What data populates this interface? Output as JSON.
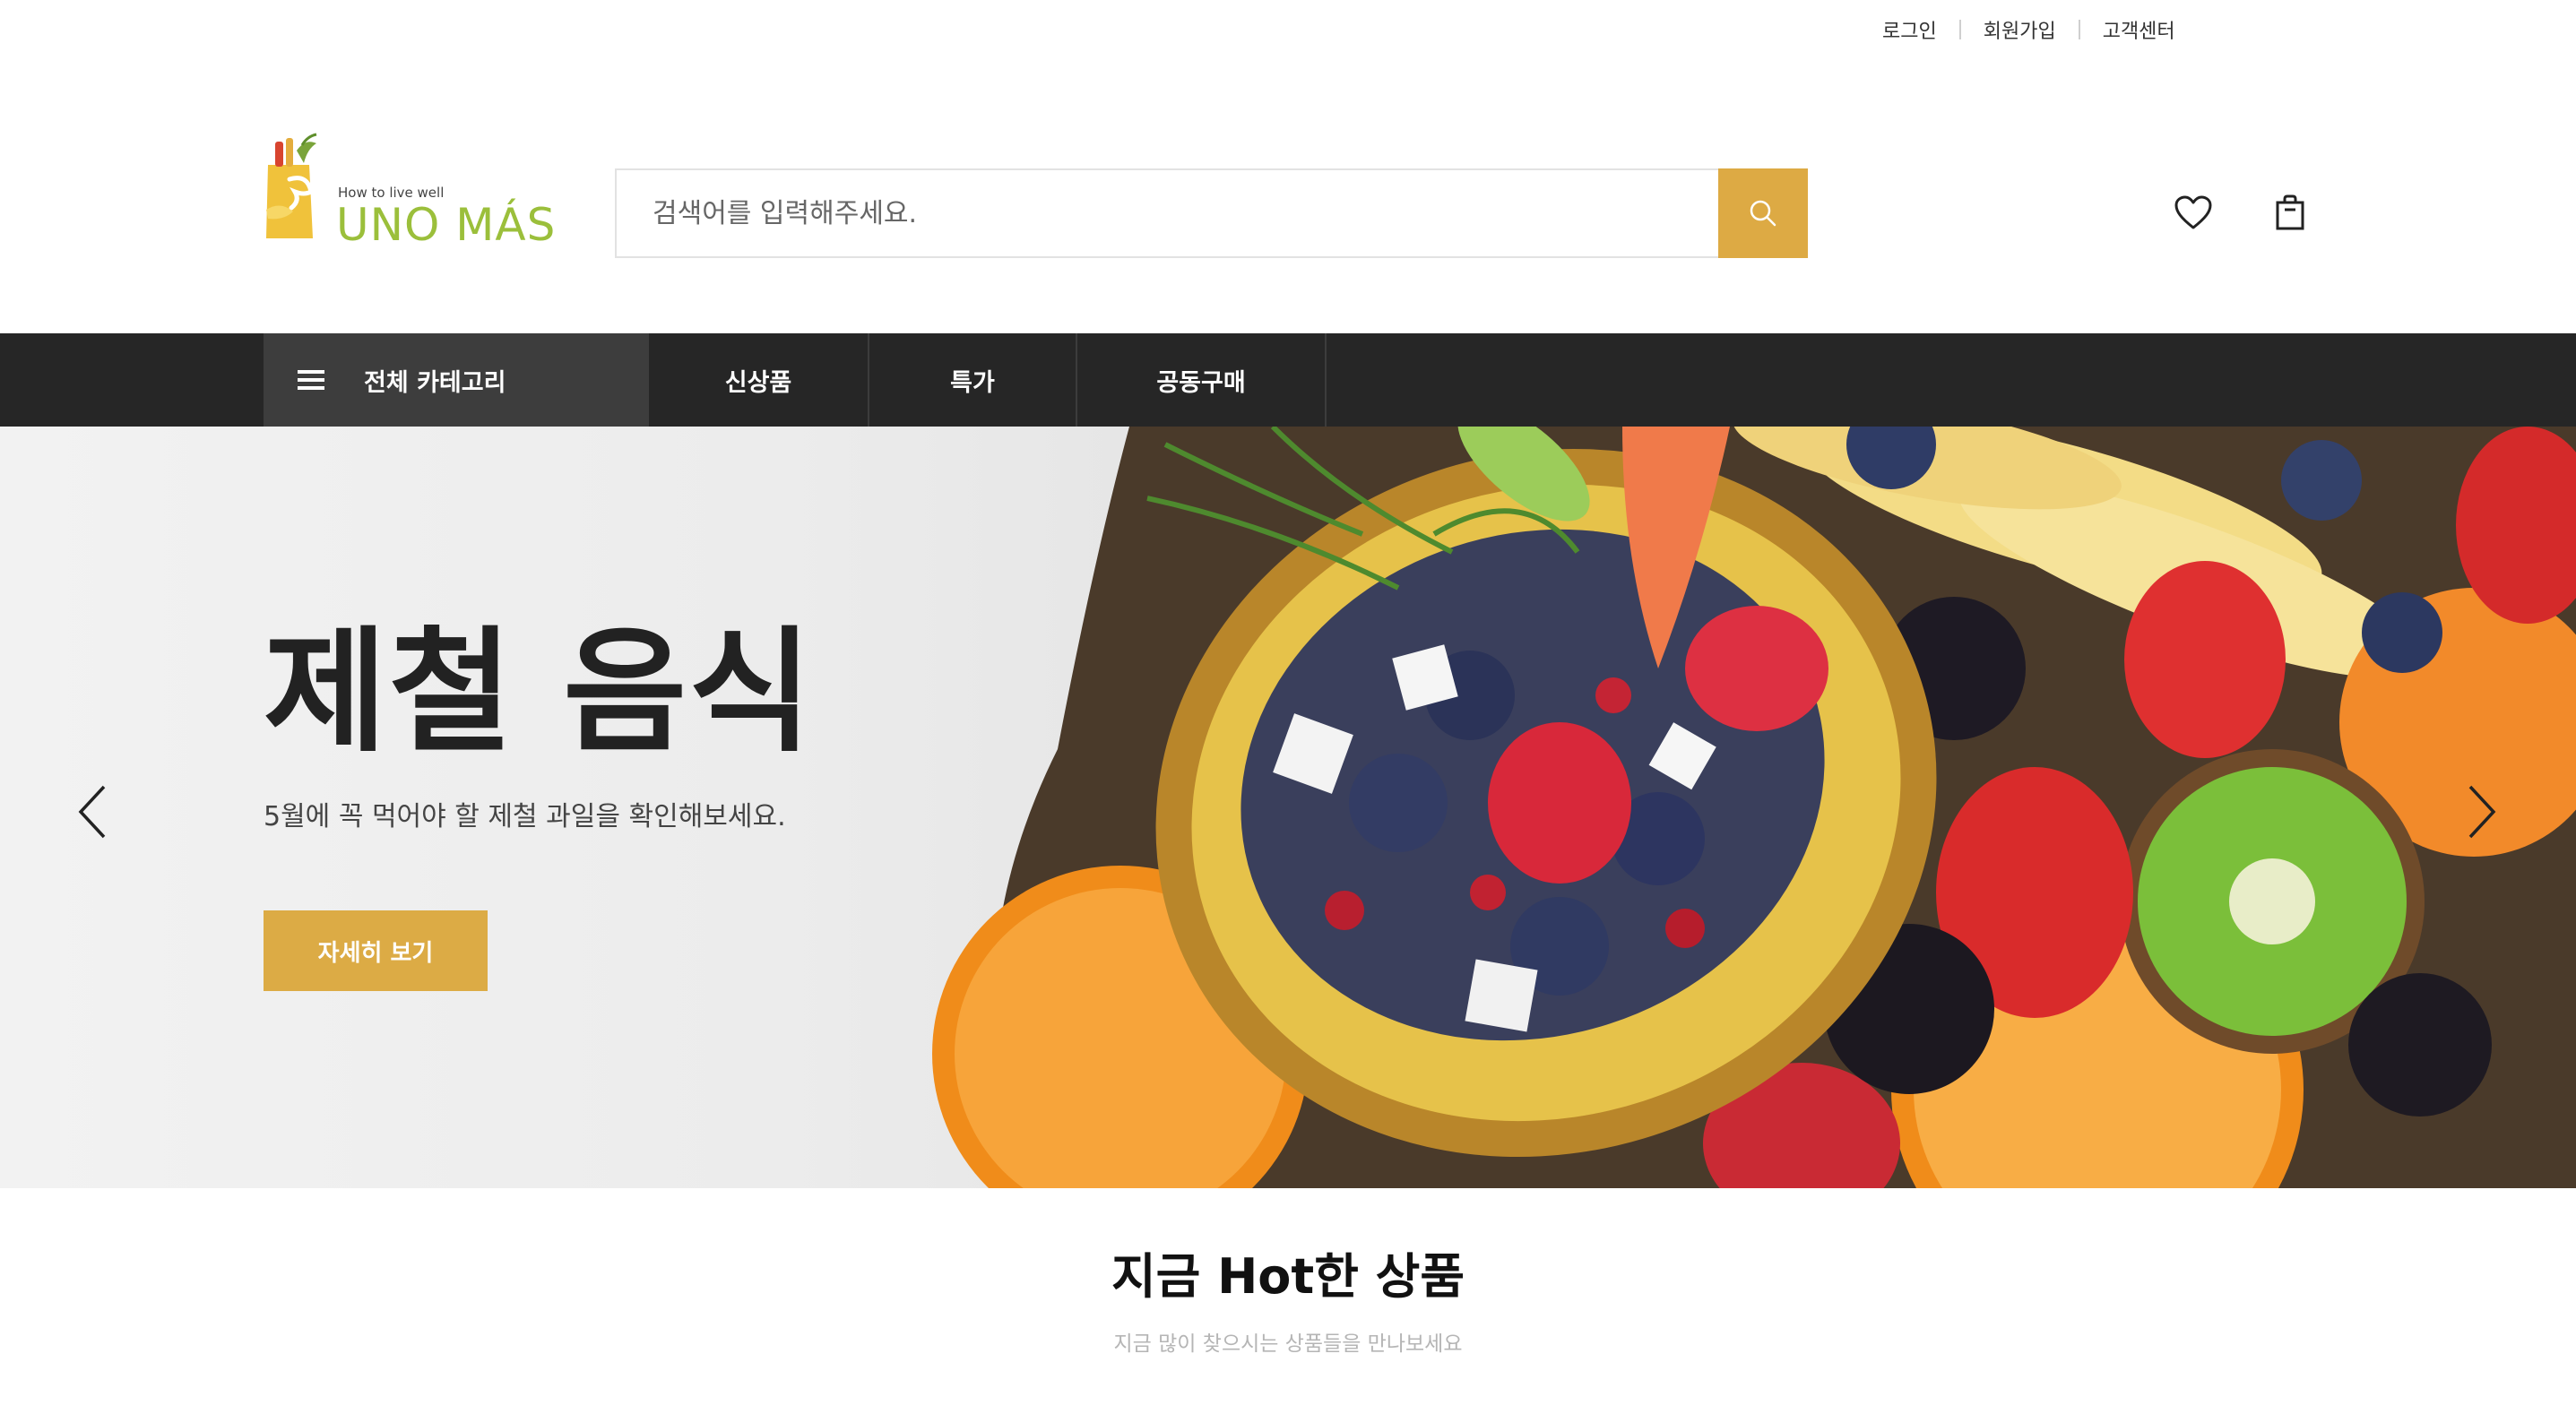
{
  "util_links": {
    "login": "로그인",
    "signup": "회원가입",
    "support": "고객센터"
  },
  "logo": {
    "tagline": "How to live well",
    "brand": "UNO MÁS"
  },
  "search": {
    "placeholder": "검색어를 입력해주세요."
  },
  "icons": {
    "search": "search-icon",
    "wishlist": "heart-icon",
    "cart": "shopping-bag-icon",
    "menu": "hamburger-icon"
  },
  "nav": {
    "all_categories": "전체 카테고리",
    "items": [
      "신상품",
      "특가",
      "공동구매"
    ]
  },
  "hero": {
    "title": "제철 음식",
    "subtitle": "5월에 꼭 먹어야 할 제철 과일을 확인해보세요.",
    "button": "자세히 보기"
  },
  "section": {
    "title": "지금 Hot한 상품",
    "subtitle": "지금 많이 찾으시는 상품들을 만나보세요"
  },
  "colors": {
    "accent": "#DDAA44",
    "nav_bg": "#262626",
    "nav_active": "#3D3D3D",
    "brand_green": "#8DB33A"
  }
}
